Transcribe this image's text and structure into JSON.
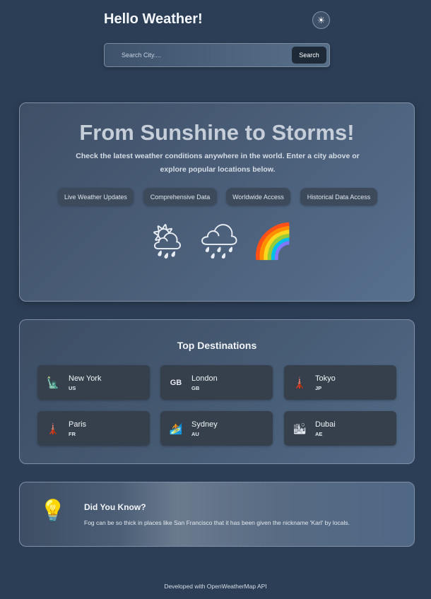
{
  "header": {
    "title": "Hello Weather!",
    "theme_icon": "sun-icon"
  },
  "search": {
    "placeholder": "Search City....",
    "value": "",
    "button_label": "Search"
  },
  "hero": {
    "title": "From Sunshine to Storms!",
    "description": "Check the latest weather conditions anywhere in the world. Enter a city above or explore popular locations below.",
    "chips": [
      "Live Weather Updates",
      "Comprehensive Data",
      "Worldwide Access",
      "Historical Data Access"
    ],
    "icons": [
      "sun-behind-cloud-icon",
      "rain-cloud-icon",
      "rainbow-icon"
    ]
  },
  "destinations": {
    "title": "Top Destinations",
    "items": [
      {
        "name": "New York",
        "code": "US",
        "icon": "statue-of-liberty-icon"
      },
      {
        "name": "London",
        "code": "GB",
        "icon": "gb-text-icon",
        "icon_text": "GB"
      },
      {
        "name": "Tokyo",
        "code": "JP",
        "icon": "tokyo-tower-icon"
      },
      {
        "name": "Paris",
        "code": "FR",
        "icon": "eiffel-tower-icon"
      },
      {
        "name": "Sydney",
        "code": "AU",
        "icon": "surfer-icon"
      },
      {
        "name": "Dubai",
        "code": "AE",
        "icon": "city-skyline-icon"
      }
    ]
  },
  "fact": {
    "title": "Did You Know?",
    "text": "Fog can be so thick in places like San Francisco that it has been given the nickname 'Karl' by locals.",
    "icon": "light-bulb-icon"
  },
  "footer": {
    "text": "Developed with OpenWeatherMap API"
  },
  "colors": {
    "page_background": "#2c3e55",
    "card_background": "#36404d",
    "search_button": "#1f2a38"
  }
}
